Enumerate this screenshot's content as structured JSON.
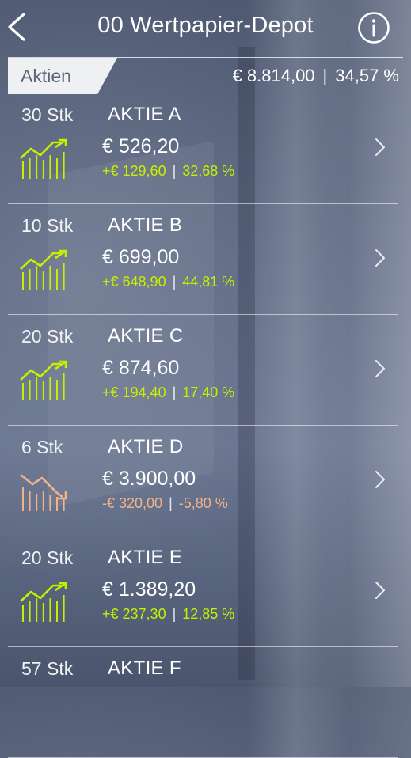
{
  "header": {
    "title": "00 Wertpapier-Depot"
  },
  "section": {
    "label": "Aktien",
    "total": "€ 8.814,00",
    "percent": "34,57 %"
  },
  "items": [
    {
      "qty": "30 Stk",
      "name": "AKTIE A",
      "price": "€ 526,20",
      "change": "+€ 129,60",
      "change_pct": "32,68 %",
      "trend": "up"
    },
    {
      "qty": "10 Stk",
      "name": "AKTIE B",
      "price": "€ 699,00",
      "change": "+€ 648,90",
      "change_pct": "44,81 %",
      "trend": "up"
    },
    {
      "qty": "20 Stk",
      "name": "AKTIE C",
      "price": "€ 874,60",
      "change": "+€ 194,40",
      "change_pct": "17,40 %",
      "trend": "up"
    },
    {
      "qty": "6 Stk",
      "name": "AKTIE D",
      "price": "€ 3.900,00",
      "change": "-€ 320,00",
      "change_pct": "-5,80 %",
      "trend": "down"
    },
    {
      "qty": "20 Stk",
      "name": "AKTIE E",
      "price": "€ 1.389,20",
      "change": "+€ 237,30",
      "change_pct": "12,85 %",
      "trend": "up"
    },
    {
      "qty": "57 Stk",
      "name": "AKTIE F",
      "price": "",
      "change": "",
      "change_pct": "",
      "trend": "up"
    }
  ],
  "colors": {
    "positive": "#c7f000",
    "negative": "#f3b389"
  },
  "icons": {
    "back": "chevron-left-icon",
    "info": "info-icon",
    "up": "trend-up-icon",
    "down": "trend-down-icon",
    "row": "chevron-right-icon"
  }
}
